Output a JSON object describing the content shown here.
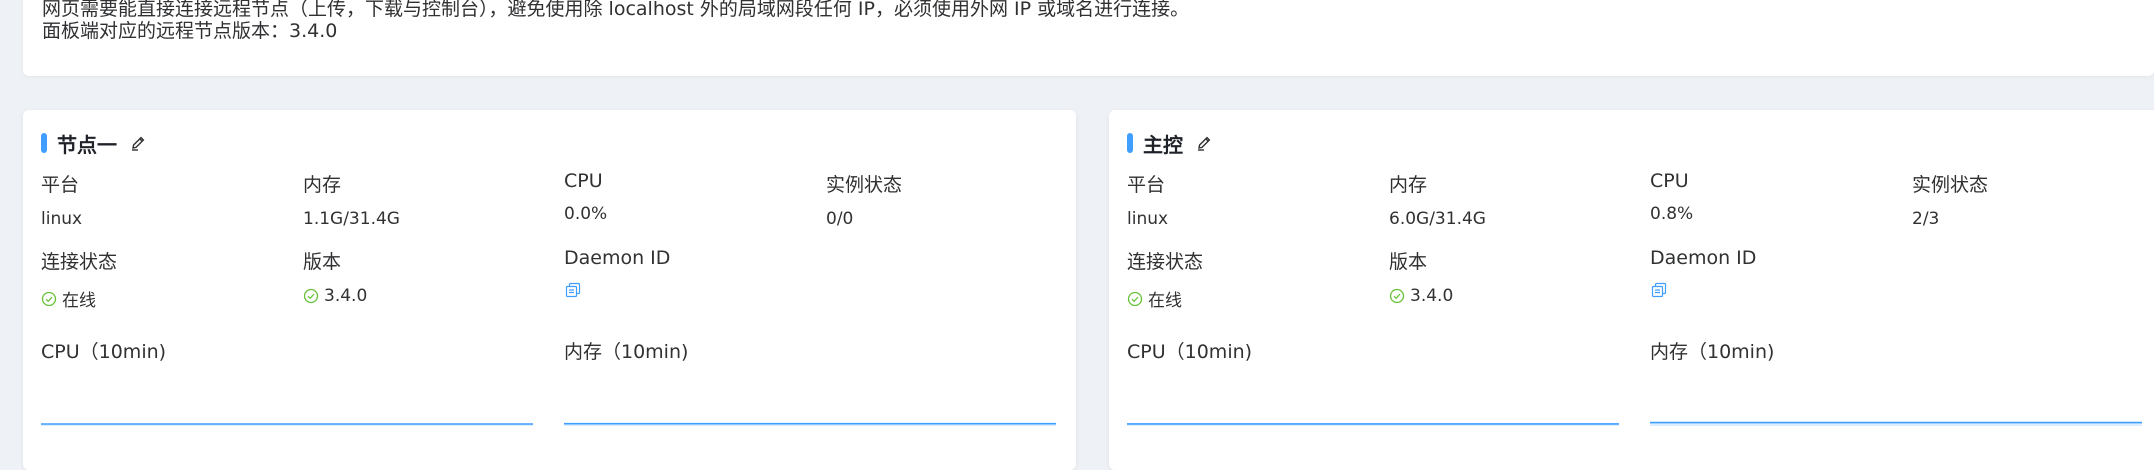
{
  "notice": {
    "line1": "网页需要能直接连接远程节点（上传，下载与控制台），避免使用除 localhost 外的局域网段任何 IP，必须使用外网 IP 或域名进行连接。",
    "line2": "面板端对应的远程节点版本：3.4.0"
  },
  "labels": {
    "platform": "平台",
    "memory": "内存",
    "cpu": "CPU",
    "instances": "实例状态",
    "connection": "连接状态",
    "version": "版本",
    "daemon_id": "Daemon ID",
    "cpu_chart": "CPU（10min)",
    "mem_chart": "内存（10min)"
  },
  "colors": {
    "accent": "#409eff",
    "online": "#67c23a"
  },
  "nodes": [
    {
      "name": "节点一",
      "platform": "linux",
      "memory": "1.1G/31.4G",
      "cpu": "0.0%",
      "instances": "0/0",
      "status": "在线",
      "version": "3.4.0",
      "cpu_history": [
        0,
        0,
        0,
        0,
        0,
        0,
        0,
        0,
        0,
        0
      ],
      "mem_history": [
        3.5,
        3.5,
        3.5,
        3.5,
        3.5,
        3.5,
        3.5,
        3.5,
        3.5,
        3.5
      ]
    },
    {
      "name": "主控",
      "platform": "linux",
      "memory": "6.0G/31.4G",
      "cpu": "0.8%",
      "instances": "2/3",
      "status": "在线",
      "version": "3.4.0",
      "cpu_history": [
        0.8,
        0.8,
        0.8,
        0.8,
        0.8,
        0.8,
        0.8,
        0.8,
        0.8,
        0.8
      ],
      "mem_history": [
        19,
        19,
        19,
        19,
        19,
        19,
        19,
        19,
        19,
        19
      ]
    }
  ]
}
